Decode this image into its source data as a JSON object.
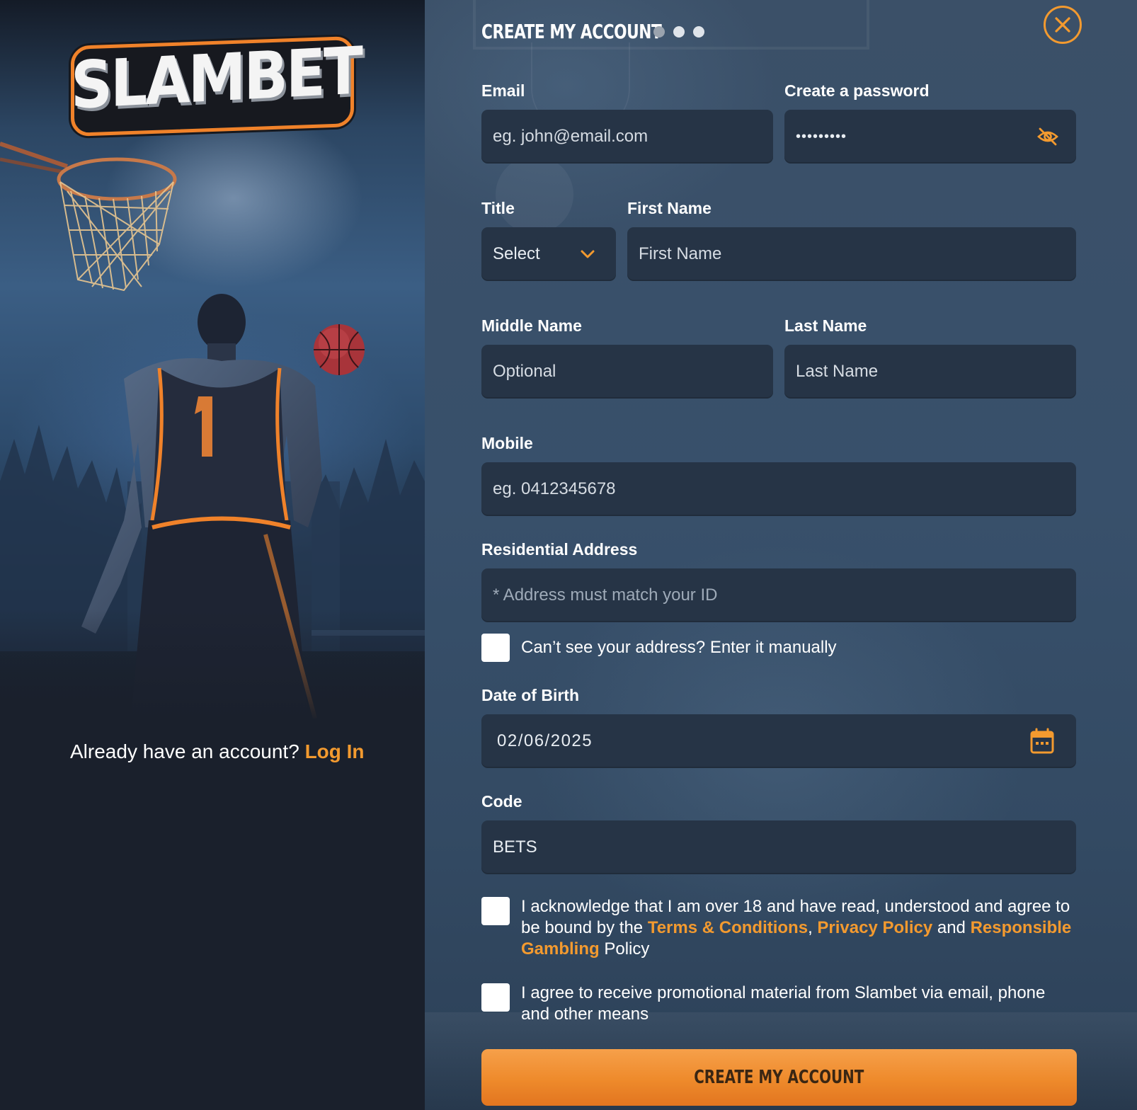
{
  "brand": {
    "logo_text": "SLAMBET",
    "accent_color": "#f39a2f"
  },
  "left": {
    "login_prompt": "Already have an account?",
    "login_link": "Log In"
  },
  "form": {
    "title": "CREATE MY ACCOUNT",
    "steps": {
      "total": 3,
      "current": 1
    },
    "close_icon": "close-icon",
    "email": {
      "label": "Email",
      "placeholder": "eg. john@email.com"
    },
    "password": {
      "label": "Create a password",
      "value": "•••••••••",
      "icon": "eye-off-icon"
    },
    "title_field": {
      "label": "Title",
      "selected": "Select",
      "icon": "chevron-down-icon"
    },
    "first_name": {
      "label": "First Name",
      "placeholder": "First Name"
    },
    "middle_name": {
      "label": "Middle Name",
      "placeholder": "Optional"
    },
    "last_name": {
      "label": "Last Name",
      "placeholder": "Last Name"
    },
    "mobile": {
      "label": "Mobile",
      "placeholder": "eg. 0412345678"
    },
    "address": {
      "label": "Residential Address",
      "placeholder": "* Address must match your ID"
    },
    "manual_address": {
      "label": "Can’t see your address? Enter it manually",
      "checked": false
    },
    "dob": {
      "label": "Date of Birth",
      "value": "02/06/2025",
      "icon": "calendar-icon"
    },
    "code": {
      "label": "Code",
      "value": "BETS"
    },
    "terms": {
      "checked": false,
      "text_1": "I acknowledge that I am over 18 and have read, understood and agree to be bound by the",
      "terms_link": "Terms & Conditions",
      "sep": ",",
      "privacy_link": "Privacy Policy",
      "and": "and",
      "gambling_link": "Responsible Gambling",
      "policy": "Policy"
    },
    "promo": {
      "checked": false,
      "text": "I agree to receive promotional material from Slambet via email, phone and other means"
    },
    "submit_label": "CREATE MY ACCOUNT"
  }
}
